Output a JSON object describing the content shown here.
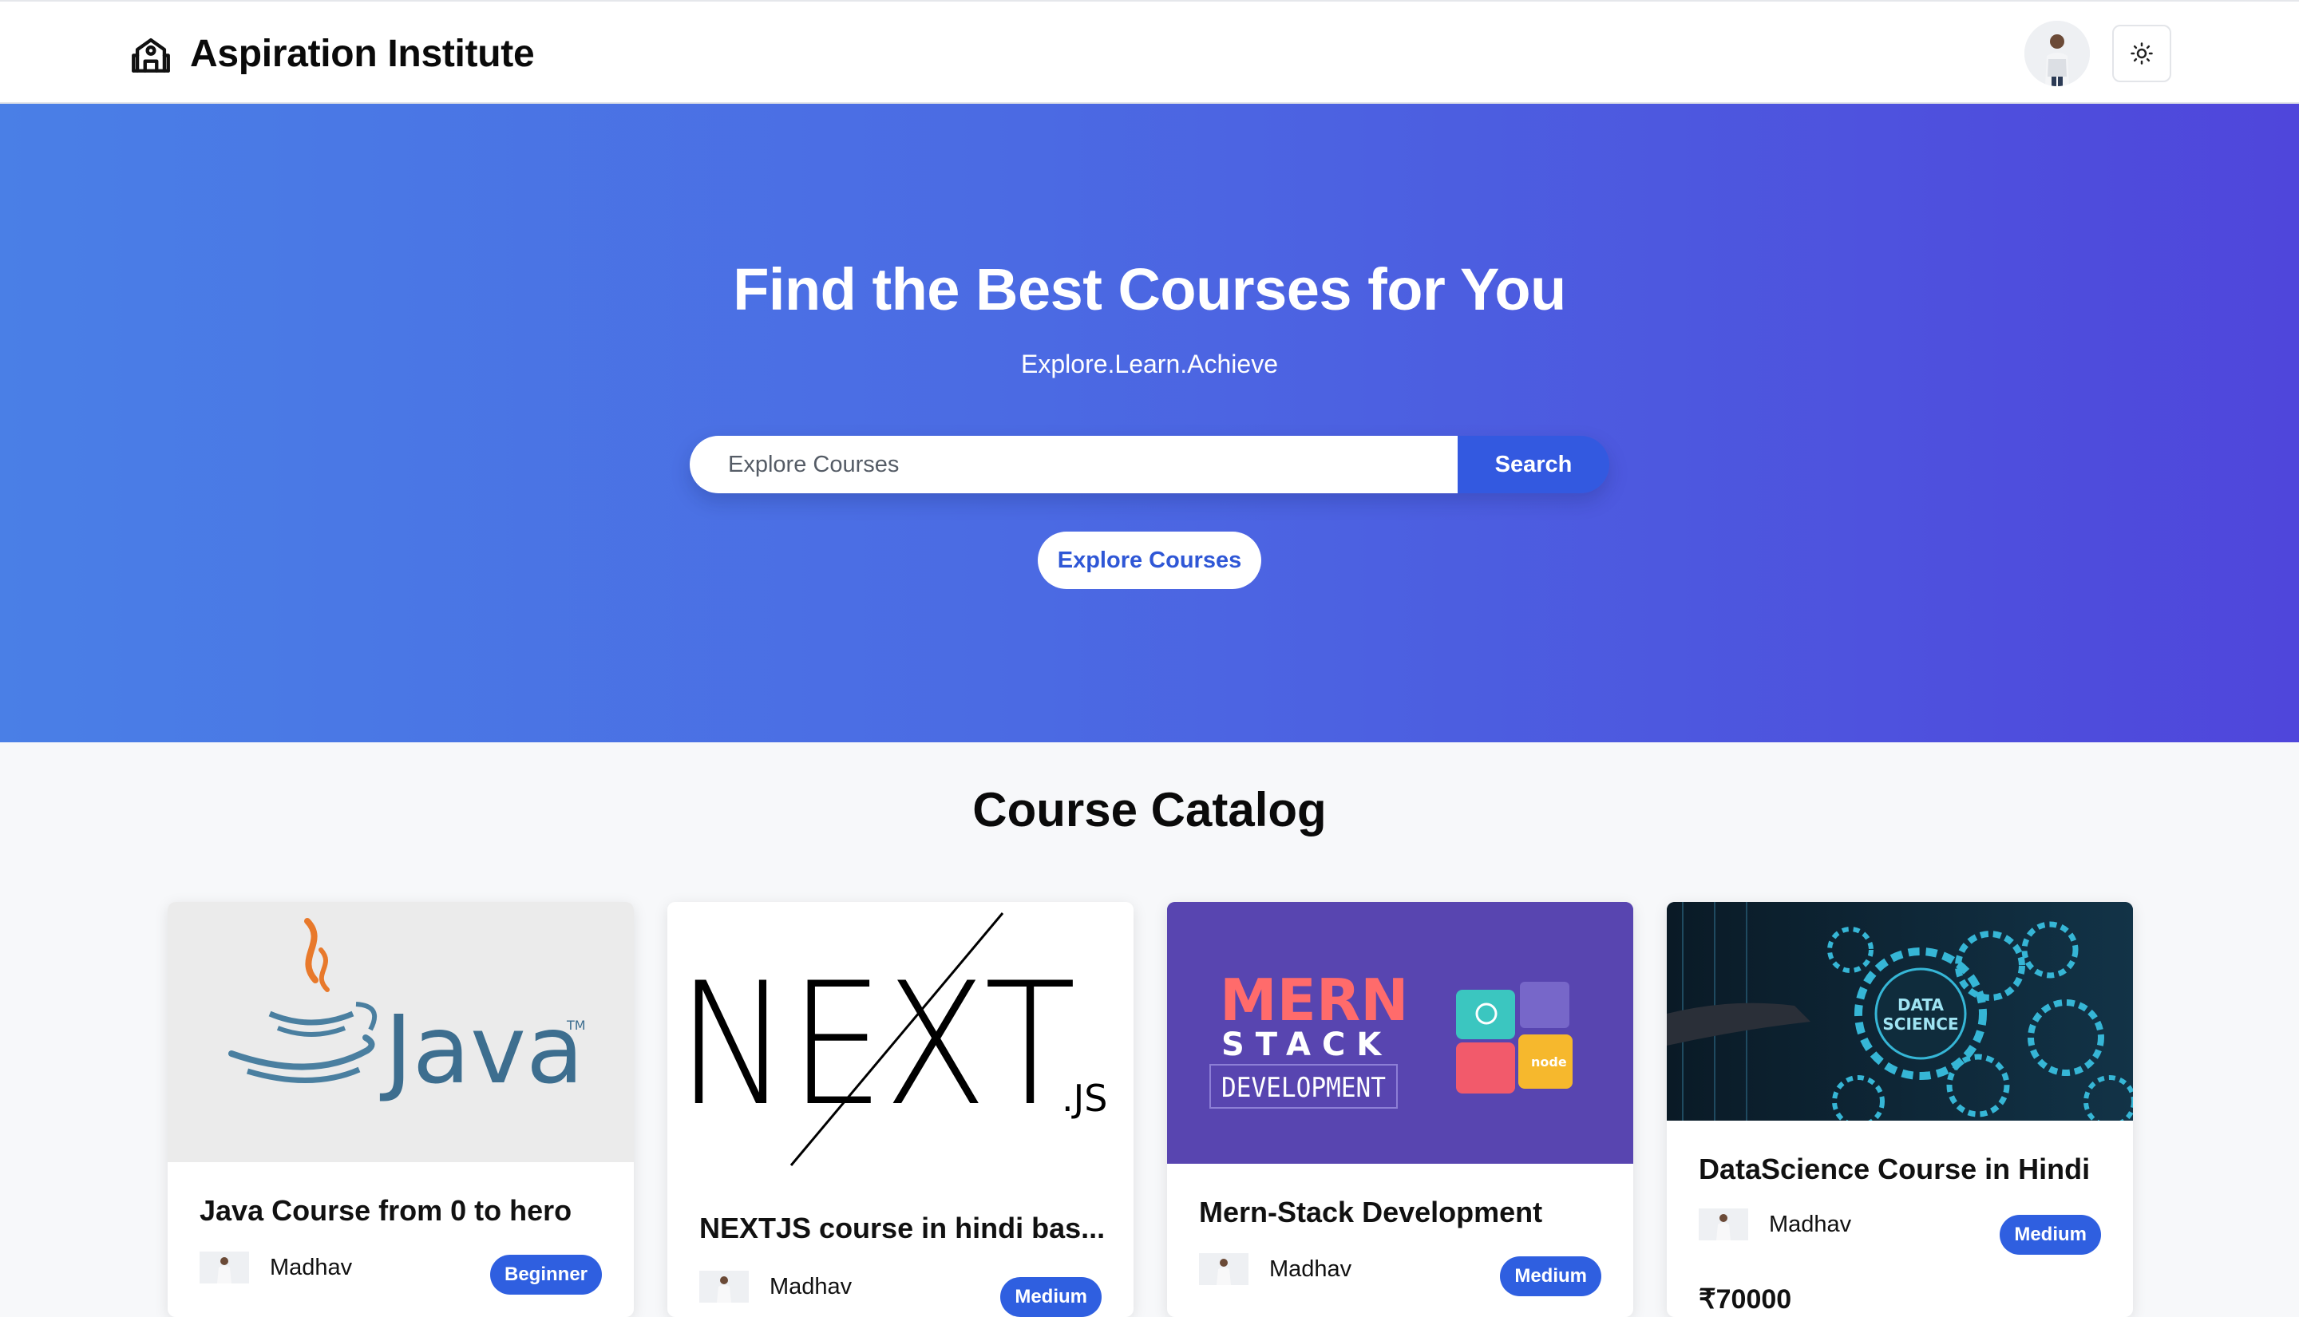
{
  "navbar": {
    "brand_title": "Aspiration Institute",
    "brand_icon": "school-icon",
    "theme_icon": "sun-icon"
  },
  "hero": {
    "title": "Find the Best Courses for You",
    "subtitle": "Explore.Learn.Achieve",
    "search_placeholder": "Explore Courses",
    "search_button": "Search",
    "explore_button": "Explore Courses"
  },
  "catalog": {
    "title": "Course Catalog",
    "courses": [
      {
        "title": "Java Course from 0 to hero",
        "author": "Madhav",
        "level": "Beginner",
        "price": "",
        "image_text": "Java"
      },
      {
        "title": "NEXTJS course in hindi bas...",
        "author": "Madhav",
        "level": "Medium",
        "price": "",
        "image_text": "NEXT",
        "image_text2": ".JS"
      },
      {
        "title": "Mern-Stack Development",
        "author": "Madhav",
        "level": "Medium",
        "price": "",
        "image_text": "MERN",
        "image_text2": "STACK",
        "image_text3": "DEVELOPMENT"
      },
      {
        "title": "DataScience Course in Hindi",
        "author": "Madhav",
        "level": "Medium",
        "price": "₹70000",
        "image_text": "DATA",
        "image_text2": "SCIENCE"
      }
    ]
  },
  "colors": {
    "hero_start": "#4a7fe6",
    "hero_end": "#4f46db",
    "accent": "#3359e0",
    "badge": "#2f5fe0"
  }
}
